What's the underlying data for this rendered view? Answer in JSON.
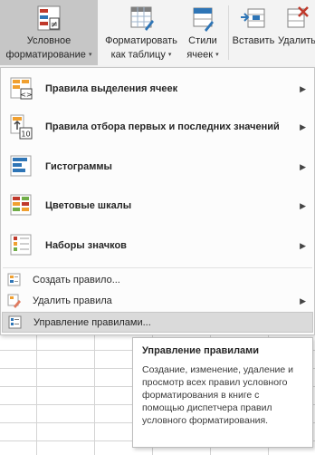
{
  "ribbon": {
    "conditional_formatting": {
      "line1": "Условное",
      "line2": "форматирование"
    },
    "format_as_table": {
      "line1": "Форматировать",
      "line2": "как таблицу"
    },
    "cell_styles": {
      "line1": "Стили",
      "line2": "ячеек"
    },
    "insert": {
      "line1": "Вставить"
    },
    "delete": {
      "line1": "Удалить"
    },
    "caret": "▾"
  },
  "menu": {
    "items": [
      {
        "label": "Правила выделения ячеек",
        "icon": "highlight-rules-icon",
        "has_submenu": true
      },
      {
        "label": "Правила отбора первых и последних значений",
        "icon": "top-bottom-rules-icon",
        "icon_text": "10",
        "has_submenu": true
      },
      {
        "label": "Гистограммы",
        "icon": "data-bars-icon",
        "has_submenu": true
      },
      {
        "label": "Цветовые шкалы",
        "icon": "color-scales-icon",
        "has_submenu": true
      },
      {
        "label": "Наборы значков",
        "icon": "icon-sets-icon",
        "has_submenu": true
      }
    ],
    "small_items": [
      {
        "label": "Создать правило...",
        "icon": "new-rule-icon",
        "has_submenu": false
      },
      {
        "label": "Удалить правила",
        "icon": "clear-rules-icon",
        "has_submenu": true
      },
      {
        "label": "Управление правилами...",
        "icon": "manage-rules-icon",
        "has_submenu": false,
        "highlighted": true
      }
    ],
    "submenu_arrow": "▶"
  },
  "tooltip": {
    "title": "Управление правилами",
    "body": "Создание, изменение, удаление и просмотр всех правил условного форматирования в книге с помощью диспетчера правил условного форматирования."
  },
  "colors": {
    "ribbon_bg": "#f3f3f3",
    "pressed": "#c6c6c6",
    "highlight": "#dadada",
    "accent_red": "#c0392b",
    "accent_blue": "#2e75b6",
    "accent_orange": "#f0a030",
    "accent_green": "#70ad47"
  }
}
